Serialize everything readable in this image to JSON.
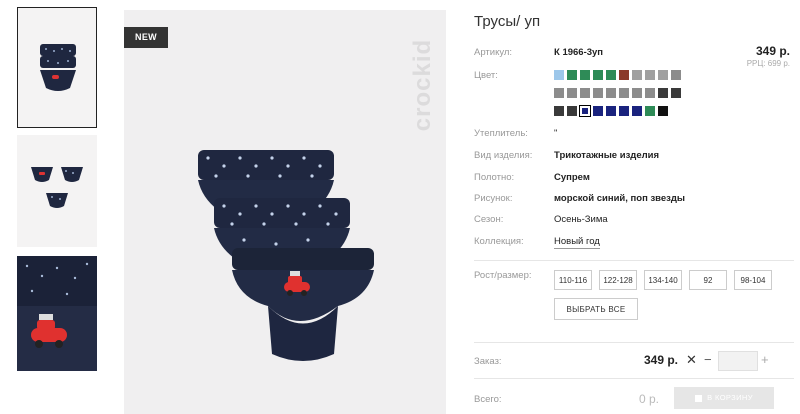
{
  "thumbnails": [
    {
      "alt": "3 briefs stacked"
    },
    {
      "alt": "3 briefs laid out"
    },
    {
      "alt": "close-up car print"
    }
  ],
  "main_image": {
    "badge": "NEW",
    "brand_watermark": "crockid"
  },
  "product": {
    "title": "Трусы/ уп",
    "article_label": "Артикул:",
    "article_value": "К 1966-3уп",
    "price": "349 р.",
    "rrp": "РРЦ: 699 р.",
    "color_label": "Цвет:",
    "colors": [
      "#9dc7ea",
      "#2e8b57",
      "#2e8b57",
      "#2e8b57",
      "#2e8b57",
      "#8b3a2a",
      "#a0a0a0",
      "#a0a0a0",
      "#a0a0a0",
      "#8c8c8c",
      "#8c8c8c",
      "#8c8c8c",
      "#8c8c8c",
      "#8c8c8c",
      "#8c8c8c",
      "#8c8c8c",
      "#8c8c8c",
      "#8c8c8c",
      "#3a3a3a",
      "#3a3a3a",
      "#3a3a3a",
      "#3a3a3a",
      "#1a237e",
      "#1a237e",
      "#1a237e",
      "#1a237e",
      "#1a237e",
      "#2e8b57",
      "#111111"
    ],
    "selected_color_index": 22,
    "insulation_label": "Утеплитель:",
    "insulation_value": "\"",
    "type_label": "Вид изделия:",
    "type_value": "Трикотажные изделия",
    "fabric_label": "Полотно:",
    "fabric_value": "Супрем",
    "pattern_label": "Рисунок:",
    "pattern_value": "морской синий, поп звезды",
    "season_label": "Сезон:",
    "season_value": "Осень-Зима",
    "collection_label": "Коллекция:",
    "collection_value": "Новый год",
    "size_label": "Рост/размер:",
    "sizes": [
      "110-116",
      "122-128",
      "134-140",
      "92",
      "98-104"
    ],
    "select_all": "ВЫБРАТЬ ВСЕ"
  },
  "order": {
    "label": "Заказ:",
    "price": "349 р.",
    "remove_symbol": "✕",
    "minus": "−",
    "plus": "+",
    "qty": ""
  },
  "total": {
    "label": "Всего:",
    "value": "0 р.",
    "cart_button": "В КОРЗИНУ"
  }
}
